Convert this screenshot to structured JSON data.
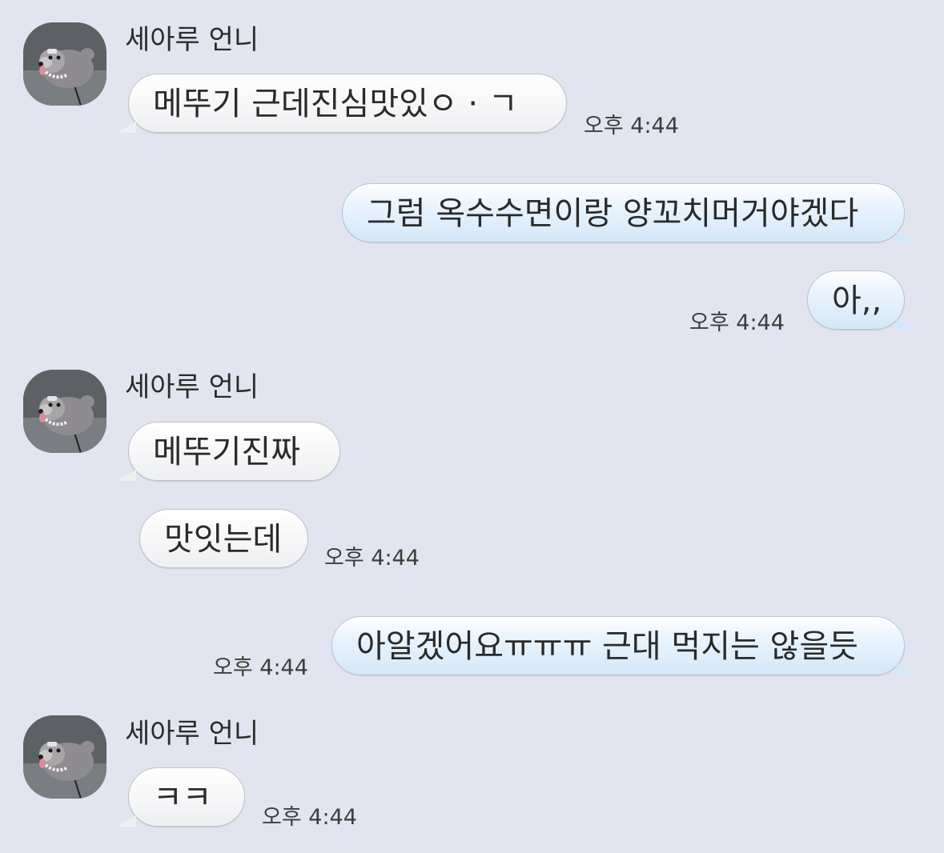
{
  "contact": {
    "name": "세아루 언니"
  },
  "messages": [
    {
      "side": "in",
      "text": "메뚜기 근데진심맛있ㅇ · ㄱ",
      "time": "오후 4:44"
    },
    {
      "side": "out",
      "text": "그럼 옥수수면이랑 양꼬치머거야겠다",
      "time": ""
    },
    {
      "side": "out",
      "text": "아,,",
      "time": "오후 4:44"
    },
    {
      "side": "in",
      "text": "메뚜기진짜",
      "time": ""
    },
    {
      "side": "in",
      "text": "맛잇는데",
      "time": "오후 4:44"
    },
    {
      "side": "out",
      "text": "아알겠어요ㅠㅠㅠ 근대 먹지는 않을듯",
      "time": "오후 4:44"
    },
    {
      "side": "in",
      "text": "ㅋㅋ",
      "time": "오후 4:44"
    }
  ],
  "colors": {
    "background": "#e2e5ef",
    "incoming_bubble": "#ffffff",
    "outgoing_bubble": "#d3e8fa"
  },
  "icons": {
    "avatar": "dog-profile-photo"
  }
}
